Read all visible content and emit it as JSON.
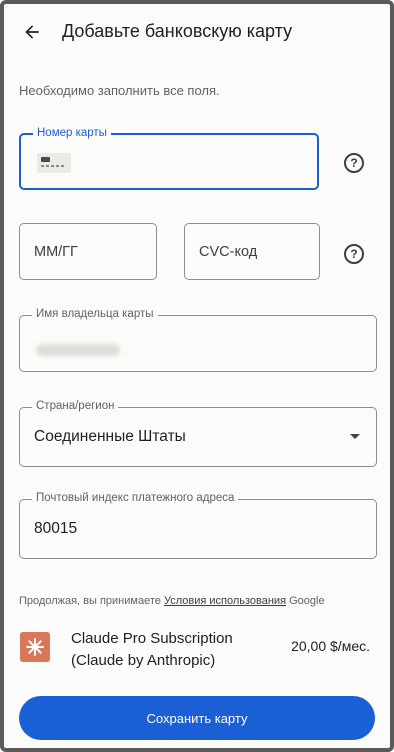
{
  "header": {
    "title": "Добавьте банковскую карту"
  },
  "form": {
    "hint": "Необходимо заполнить все поля.",
    "card_number_label": "Номер карты",
    "expiry_placeholder": "ММ/ГГ",
    "cvc_placeholder": "CVC-код",
    "cardholder_label": "Имя владельца карты",
    "country_label": "Страна/регион",
    "country_value": "Соединенные Штаты",
    "postal_label": "Почтовый индекс платежного адреса",
    "postal_value": "80015",
    "help_symbol": "?"
  },
  "terms": {
    "prefix": "Продолжая, вы принимаете",
    "link": "Условия использования",
    "suffix": "Google"
  },
  "product": {
    "name_line1": "Claude Pro Subscription",
    "name_line2": "(Claude by Anthropic)",
    "price": "20,00 $/мес."
  },
  "actions": {
    "save_label": "Сохранить карту"
  },
  "colors": {
    "accent": "#1a5fd6",
    "brand_icon": "#d9775a"
  }
}
